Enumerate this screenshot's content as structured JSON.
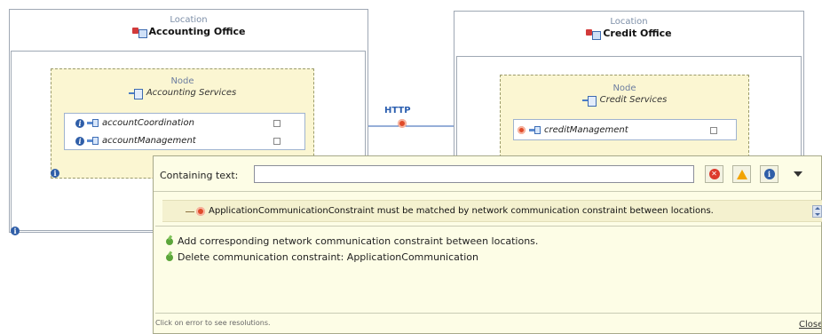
{
  "left_location": {
    "label": "Location",
    "name": "Accounting Office",
    "node": {
      "label": "Node",
      "name": "Accounting Services",
      "components": [
        "accountCoordination",
        "accountManagement"
      ]
    }
  },
  "right_location": {
    "label": "Location",
    "name": "Credit Office",
    "node": {
      "label": "Node",
      "name": "Credit Services",
      "components": [
        "creditManagement"
      ]
    }
  },
  "connection": {
    "label": "HTTP"
  },
  "popup": {
    "filter_label": "Containing text:",
    "filter_value": "",
    "error_message": "ApplicationCommunicationConstraint must be matched by network communication constraint between locations.",
    "resolutions": [
      "Add corresponding network communication constraint between locations.",
      "Delete communication constraint: ApplicationCommunication"
    ],
    "status_text": "Click on error to see resolutions.",
    "close_label": "Close"
  },
  "icons": {
    "error": "error-icon",
    "warning": "warning-icon",
    "info": "info-icon",
    "resolution": "quick-fix-icon"
  },
  "colors": {
    "node_fill": "#fbf6d2",
    "popup_fill": "#fdfde6",
    "connection": "#2c5fb0",
    "error": "#dd3a2c",
    "warning": "#f2a300",
    "info": "#2f5ea8"
  }
}
